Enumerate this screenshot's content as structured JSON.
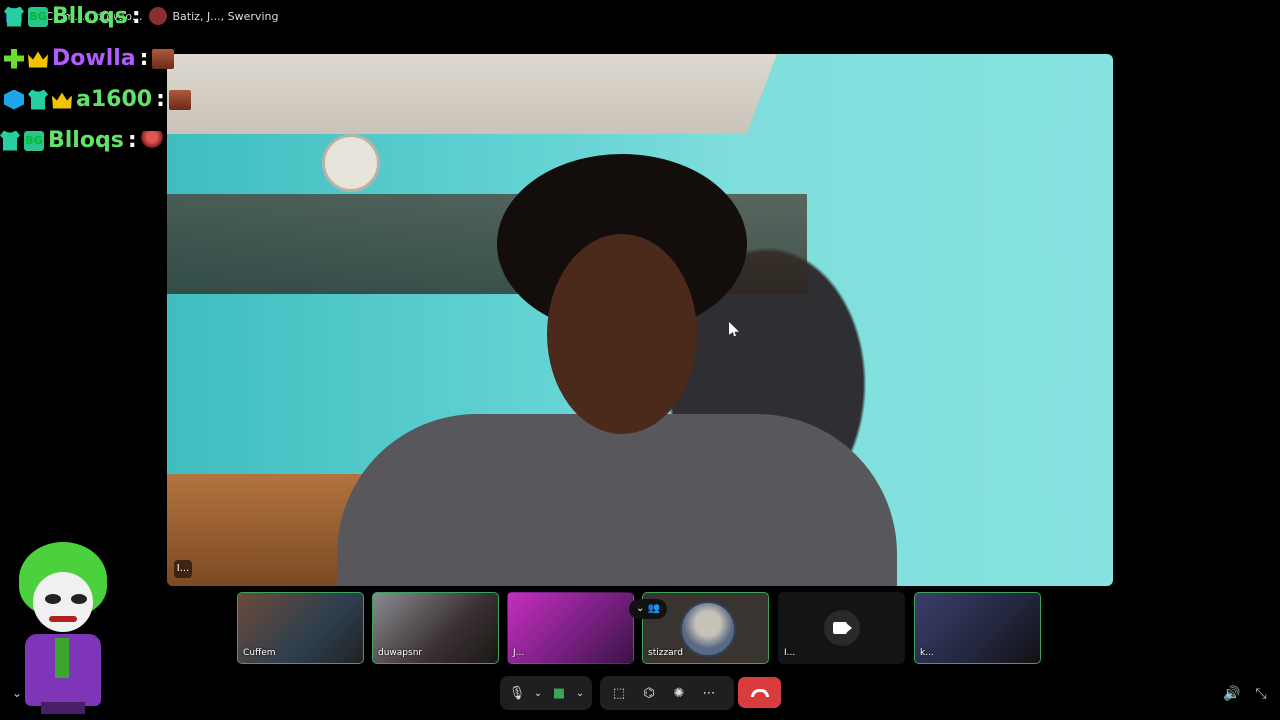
{
  "topbar": {
    "title": "d.. C...m... , duwap...",
    "participants_text": "Batiz, J..., Swerving"
  },
  "chat": [
    {
      "user": "Blloqs",
      "color": "#5fe36a",
      "badges": [
        "shirt",
        "tag"
      ],
      "tag_text": "BG",
      "emote": "person"
    },
    {
      "user": "Dowlla",
      "color": "#b25cff",
      "badges": [
        "plus",
        "crown"
      ],
      "emote": "face"
    },
    {
      "user": "a1600",
      "color": "#5fe36a",
      "badges": [
        "cube",
        "shirt",
        "crown"
      ],
      "emote": "face"
    },
    {
      "user": "Blloqs",
      "color": "#5fe36a",
      "badges": [
        "shirt",
        "tag"
      ],
      "tag_text": "BG",
      "emote": "person"
    }
  ],
  "chat_separator": ":",
  "main_video": {
    "label_button": "I..."
  },
  "tiles": [
    {
      "name": "Cuffem",
      "speaking": true,
      "kind": "video",
      "bg": "linear-gradient(135deg,#6b4a3a,#2d3f4f 60%,#222)"
    },
    {
      "name": "duwapsnr",
      "speaking": true,
      "kind": "video",
      "bg": "linear-gradient(135deg,#8a8c91,#3a3132 60%,#1b1816)"
    },
    {
      "name": "J...",
      "speaking": false,
      "kind": "video",
      "bg": "linear-gradient(135deg,#c52fbf,#7a2083 55%,#3a1444)"
    },
    {
      "name": "stizzard",
      "speaking": true,
      "kind": "avatar",
      "bg": "#3a3430"
    },
    {
      "name": "I...",
      "speaking": false,
      "kind": "camera-off",
      "bg": "#141416"
    },
    {
      "name": "k...",
      "speaking": true,
      "kind": "video",
      "bg": "linear-gradient(135deg,#3b3f6b,#23263d 60%,#111)"
    }
  ],
  "controls": {
    "mic_icon": "mic-icon",
    "camera_icon": "camera-icon",
    "share_screen_icon": "share-screen-icon",
    "activity_icon": "gamepad-icon",
    "soundboard_icon": "soundboard-icon",
    "more_icon": "more-icon",
    "end_call_icon": "end-call-icon",
    "volume_icon": "volume-icon",
    "exit_fullscreen_icon": "exit-fullscreen-icon",
    "accent": "#3ba55c",
    "danger": "#d83c3e"
  }
}
